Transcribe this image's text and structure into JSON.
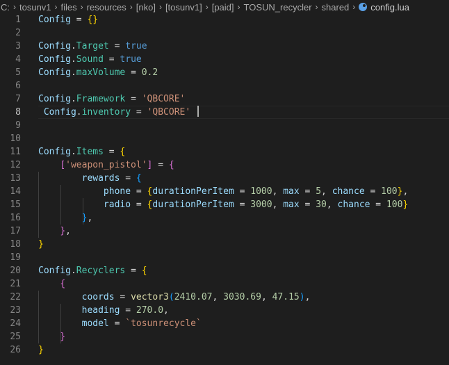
{
  "breadcrumb": {
    "segments": [
      "C:",
      "tosunv1",
      "files",
      "resources",
      "[nko]",
      "[tosunv1]",
      "[paid]",
      "TOSUN_recycler",
      "shared"
    ],
    "file": "config.lua",
    "file_icon": "lua-file-icon"
  },
  "editor": {
    "language": "lua",
    "active_line": 8,
    "colors": {
      "background": "#1e1e1e",
      "variable": "#9cdcfe",
      "property": "#4ec9b0",
      "keyword": "#569cd6",
      "number": "#b5cea8",
      "string": "#ce9178",
      "function": "#dcdcaa",
      "bracket_level_1": "#ffd700",
      "bracket_level_2": "#da70d6",
      "bracket_level_3": "#179fff"
    },
    "lines": [
      {
        "n": "1",
        "tokens": [
          [
            "var",
            "Config"
          ],
          [
            "op",
            " = "
          ],
          [
            "b1",
            "{}"
          ]
        ]
      },
      {
        "n": "2",
        "tokens": []
      },
      {
        "n": "3",
        "tokens": [
          [
            "var",
            "Config"
          ],
          [
            "op",
            "."
          ],
          [
            "prop",
            "Target"
          ],
          [
            "op",
            " = "
          ],
          [
            "kw",
            "true"
          ]
        ]
      },
      {
        "n": "4",
        "tokens": [
          [
            "var",
            "Config"
          ],
          [
            "op",
            "."
          ],
          [
            "prop",
            "Sound"
          ],
          [
            "op",
            " = "
          ],
          [
            "kw",
            "true"
          ]
        ]
      },
      {
        "n": "5",
        "tokens": [
          [
            "var",
            "Config"
          ],
          [
            "op",
            "."
          ],
          [
            "prop",
            "maxVolume"
          ],
          [
            "op",
            " = "
          ],
          [
            "num",
            "0.2"
          ]
        ]
      },
      {
        "n": "6",
        "tokens": []
      },
      {
        "n": "7",
        "tokens": [
          [
            "var",
            "Config"
          ],
          [
            "op",
            "."
          ],
          [
            "prop",
            "Framework"
          ],
          [
            "op",
            " = "
          ],
          [
            "str",
            "'QBCORE'"
          ]
        ]
      },
      {
        "n": "8",
        "tokens": [
          [
            "op",
            " "
          ],
          [
            "var",
            "Config"
          ],
          [
            "op",
            "."
          ],
          [
            "prop",
            "inventory"
          ],
          [
            "op",
            " = "
          ],
          [
            "str",
            "'QBCORE'"
          ],
          [
            "op",
            " "
          ]
        ]
      },
      {
        "n": "9",
        "tokens": []
      },
      {
        "n": "10",
        "tokens": []
      },
      {
        "n": "11",
        "tokens": [
          [
            "var",
            "Config"
          ],
          [
            "op",
            "."
          ],
          [
            "prop",
            "Items"
          ],
          [
            "op",
            " = "
          ],
          [
            "b1",
            "{"
          ]
        ]
      },
      {
        "n": "12",
        "tokens": [
          [
            "op",
            "    "
          ],
          [
            "b2",
            "["
          ],
          [
            "str",
            "'weapon_pistol'"
          ],
          [
            "b2",
            "]"
          ],
          [
            "op",
            " = "
          ],
          [
            "b2",
            "{"
          ]
        ]
      },
      {
        "n": "13",
        "tokens": [
          [
            "op",
            "        "
          ],
          [
            "var",
            "rewards"
          ],
          [
            "op",
            " = "
          ],
          [
            "b3",
            "{"
          ]
        ]
      },
      {
        "n": "14",
        "tokens": [
          [
            "op",
            "            "
          ],
          [
            "var",
            "phone"
          ],
          [
            "op",
            " = "
          ],
          [
            "b1",
            "{"
          ],
          [
            "var",
            "durationPerItem"
          ],
          [
            "op",
            " = "
          ],
          [
            "num",
            "1000"
          ],
          [
            "op",
            ", "
          ],
          [
            "var",
            "max"
          ],
          [
            "op",
            " = "
          ],
          [
            "num",
            "5"
          ],
          [
            "op",
            ", "
          ],
          [
            "var",
            "chance"
          ],
          [
            "op",
            " = "
          ],
          [
            "num",
            "100"
          ],
          [
            "b1",
            "}"
          ],
          [
            "op",
            ","
          ]
        ]
      },
      {
        "n": "15",
        "tokens": [
          [
            "op",
            "            "
          ],
          [
            "var",
            "radio"
          ],
          [
            "op",
            " = "
          ],
          [
            "b1",
            "{"
          ],
          [
            "var",
            "durationPerItem"
          ],
          [
            "op",
            " = "
          ],
          [
            "num",
            "3000"
          ],
          [
            "op",
            ", "
          ],
          [
            "var",
            "max"
          ],
          [
            "op",
            " = "
          ],
          [
            "num",
            "30"
          ],
          [
            "op",
            ", "
          ],
          [
            "var",
            "chance"
          ],
          [
            "op",
            " = "
          ],
          [
            "num",
            "100"
          ],
          [
            "b1",
            "}"
          ]
        ]
      },
      {
        "n": "16",
        "tokens": [
          [
            "op",
            "        "
          ],
          [
            "b3",
            "}"
          ],
          [
            "op",
            ","
          ]
        ]
      },
      {
        "n": "17",
        "tokens": [
          [
            "op",
            "    "
          ],
          [
            "b2",
            "}"
          ],
          [
            "op",
            ","
          ]
        ]
      },
      {
        "n": "18",
        "tokens": [
          [
            "b1",
            "}"
          ]
        ]
      },
      {
        "n": "19",
        "tokens": []
      },
      {
        "n": "20",
        "tokens": [
          [
            "var",
            "Config"
          ],
          [
            "op",
            "."
          ],
          [
            "prop",
            "Recyclers"
          ],
          [
            "op",
            " = "
          ],
          [
            "b1",
            "{"
          ]
        ]
      },
      {
        "n": "21",
        "tokens": [
          [
            "op",
            "    "
          ],
          [
            "b2",
            "{"
          ]
        ]
      },
      {
        "n": "22",
        "tokens": [
          [
            "op",
            "        "
          ],
          [
            "var",
            "coords"
          ],
          [
            "op",
            " = "
          ],
          [
            "fn",
            "vector3"
          ],
          [
            "b3",
            "("
          ],
          [
            "num",
            "2410.07"
          ],
          [
            "op",
            ", "
          ],
          [
            "num",
            "3030.69"
          ],
          [
            "op",
            ", "
          ],
          [
            "num",
            "47.15"
          ],
          [
            "b3",
            ")"
          ],
          [
            "op",
            ","
          ]
        ]
      },
      {
        "n": "23",
        "tokens": [
          [
            "op",
            "        "
          ],
          [
            "var",
            "heading"
          ],
          [
            "op",
            " = "
          ],
          [
            "num",
            "270.0"
          ],
          [
            "op",
            ","
          ]
        ]
      },
      {
        "n": "24",
        "tokens": [
          [
            "op",
            "        "
          ],
          [
            "var",
            "model"
          ],
          [
            "op",
            " = "
          ],
          [
            "str",
            "`tosunrecycle`"
          ]
        ]
      },
      {
        "n": "25",
        "tokens": [
          [
            "op",
            "    "
          ],
          [
            "b2",
            "}"
          ]
        ]
      },
      {
        "n": "26",
        "tokens": [
          [
            "b1",
            "}"
          ]
        ]
      }
    ]
  }
}
